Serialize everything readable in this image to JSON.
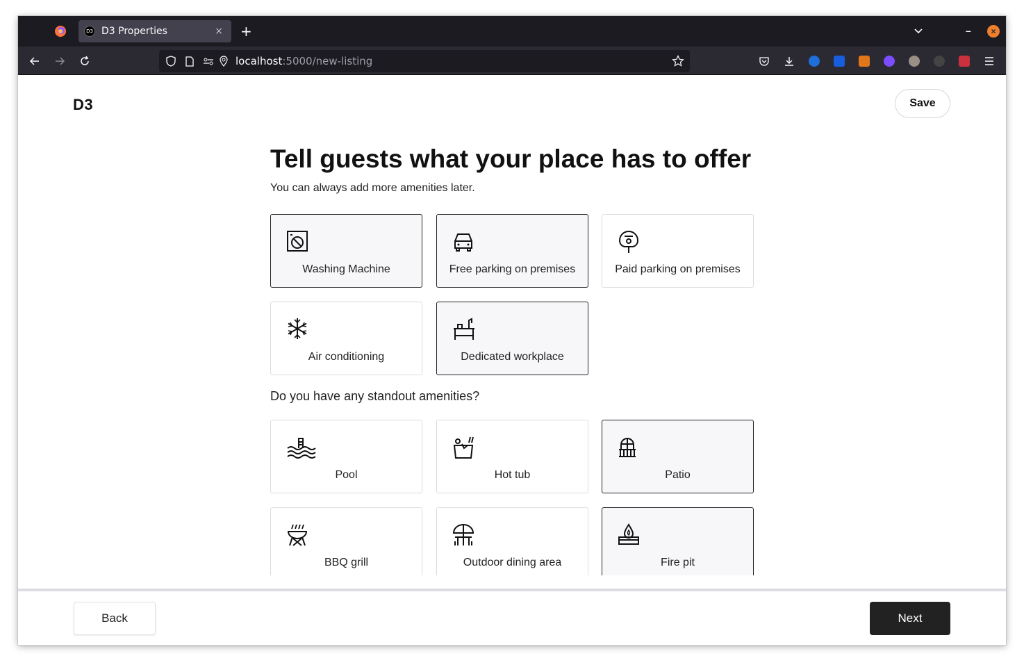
{
  "browser": {
    "tab_title": "D3 Properties",
    "tab_favicon_text": "D3",
    "tab_close": "×",
    "new_tab": "+",
    "url_host": "localhost",
    "url_path": ":5000/new-listing",
    "minimize": "–",
    "close": "×"
  },
  "header": {
    "logo": "D3",
    "save_label": "Save"
  },
  "main": {
    "title": "Tell guests what your place has to offer",
    "subtitle": "You can always add more amenities later.",
    "standout_heading": "Do you have any standout amenities?"
  },
  "amenities": [
    {
      "label": "Washing Machine",
      "icon": "washing-machine-icon",
      "selected": true
    },
    {
      "label": "Free parking on premises",
      "icon": "car-icon",
      "selected": true
    },
    {
      "label": "Paid parking on premises",
      "icon": "parking-meter-icon",
      "selected": false
    },
    {
      "label": "Air conditioning",
      "icon": "snowflake-icon",
      "selected": false
    },
    {
      "label": "Dedicated workplace",
      "icon": "desk-icon",
      "selected": true
    }
  ],
  "standout": [
    {
      "label": "Pool",
      "icon": "pool-icon",
      "selected": false
    },
    {
      "label": "Hot tub",
      "icon": "hot-tub-icon",
      "selected": false
    },
    {
      "label": "Patio",
      "icon": "patio-icon",
      "selected": true
    },
    {
      "label": "BBQ grill",
      "icon": "grill-icon",
      "selected": false
    },
    {
      "label": "Outdoor dining area",
      "icon": "outdoor-dining-icon",
      "selected": false
    },
    {
      "label": "Fire pit",
      "icon": "fire-pit-icon",
      "selected": true
    }
  ],
  "footer": {
    "back_label": "Back",
    "next_label": "Next"
  }
}
